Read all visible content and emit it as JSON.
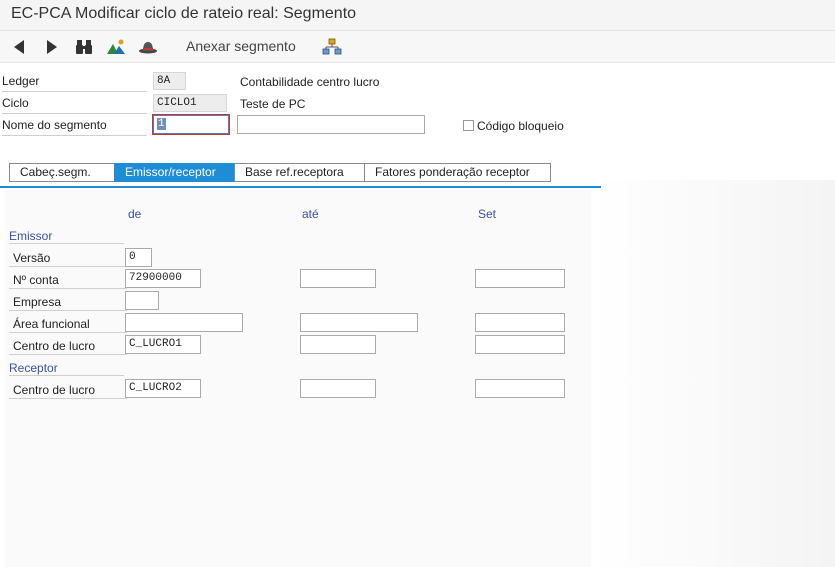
{
  "window": {
    "title": "EC-PCA Modificar ciclo de rateio real: Segmento"
  },
  "toolbar": {
    "back_icon": "back-icon",
    "forward_icon": "forward-icon",
    "find_icon": "binoculars-icon",
    "landscape_icon": "mountain-icon",
    "hat_icon": "hat-icon",
    "attach_label": "Anexar segmento",
    "hierarchy_icon": "hierarchy-icon"
  },
  "header": {
    "ledger_label": "Ledger",
    "ledger_value": "8A",
    "ledger_desc": "Contabilidade centro lucro",
    "ciclo_label": "Ciclo",
    "ciclo_value": "CICLO1",
    "ciclo_desc": "Teste de PC",
    "segment_label": "Nome do segmento",
    "segment_value": "1",
    "segment_desc": "",
    "block_label": "Código bloqueio"
  },
  "tabs": [
    "Cabeç.segm.",
    "Emissor/receptor",
    "Base ref.receptora",
    "Fatores ponderação receptor"
  ],
  "active_tab": "Emissor/receptor",
  "columns": {
    "from": "de",
    "to": "até",
    "set": "Set"
  },
  "sender": {
    "title": "Emissor",
    "version_label": "Versão",
    "version_value": "0",
    "account_label": "Nº conta",
    "account_from": "72900000",
    "company_label": "Empresa",
    "company_from": "",
    "func_area_label": "Área funcional",
    "func_area_from": "",
    "profit_center_label": "Centro de lucro",
    "profit_center_from": "C_LUCRO1"
  },
  "receiver": {
    "title": "Receptor",
    "profit_center_label": "Centro de lucro",
    "profit_center_from": "C_LUCRO2"
  },
  "colors": {
    "accent": "#1f8cd6",
    "section_text": "#3a4fa8"
  }
}
